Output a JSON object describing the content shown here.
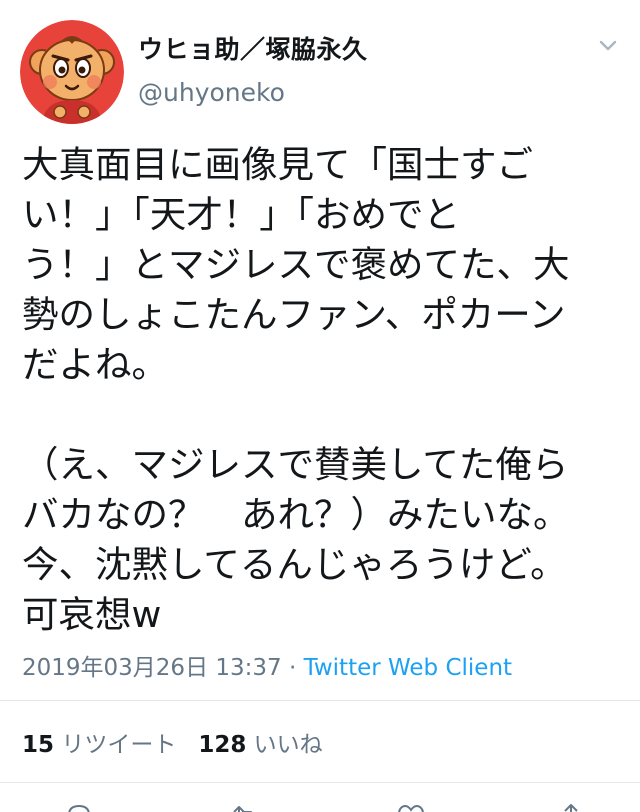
{
  "user": {
    "display_name": "ウヒョ助／塚脇永久",
    "handle": "@uhyoneko",
    "avatar_icon": "cartoon-character-avatar"
  },
  "tweet": {
    "lines": [
      "大真面目に画像見て「国士すご",
      "い！」「天才！」「おめでと",
      "う！」とマジレスで褒めてた、大",
      "勢のしょこたんファン、ポカーン",
      "だよね。",
      "",
      "（え、マジレスで賛美してた俺ら",
      "バカなの？　あれ？）みたいな。",
      "今、沈黙してるんじゃろうけど。",
      "可哀想w"
    ]
  },
  "meta": {
    "timestamp": "2019年03月26日 13:37",
    "separator": " · ",
    "source": "Twitter Web Client"
  },
  "stats": {
    "retweets_count": "15",
    "retweets_label": "リツイート",
    "likes_count": "128",
    "likes_label": "いいね"
  },
  "actions": [
    {
      "icon": "reply-icon"
    },
    {
      "icon": "retweet-icon"
    },
    {
      "icon": "like-icon"
    },
    {
      "icon": "share-icon"
    }
  ],
  "colors": {
    "text": "#14171a",
    "secondary": "#657786",
    "link": "#1da1f2",
    "divider": "#e1e8ed"
  }
}
